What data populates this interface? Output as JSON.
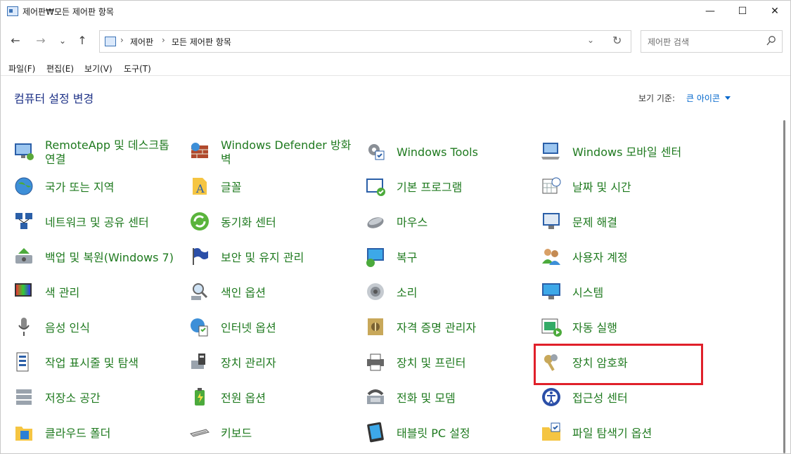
{
  "window": {
    "title": "제어판₩모든 제어판 항목"
  },
  "titlebar": {
    "minimize": "—",
    "maximize": "☐",
    "close": "✕"
  },
  "nav": {
    "back": "←",
    "forward": "→",
    "recent": "⌄",
    "up": "↑",
    "breadcrumb": [
      "제어판",
      "모든 제어판 항목"
    ],
    "separator": "›",
    "dropdown": "⌄",
    "refresh": "↻"
  },
  "search": {
    "placeholder": "제어판 검색"
  },
  "menu": [
    "파일(F)",
    "편집(E)",
    "보기(V)",
    "도구(T)"
  ],
  "content": {
    "heading": "컴퓨터 설정 변경",
    "view_by_label": "보기 기준:",
    "view_by_value": "큰 아이콘"
  },
  "colors": {
    "link_green": "#1f7a1f",
    "heading_blue": "#1e3287",
    "highlight_red": "#e0202a"
  },
  "items": [
    [
      {
        "label": "RemoteApp 및 데스크톱 연결",
        "icon": "remoteapp-icon"
      },
      {
        "label": "국가 또는 지역",
        "icon": "globe-clock-icon"
      },
      {
        "label": "네트워크 및 공유 센터",
        "icon": "network-icon"
      },
      {
        "label": "백업 및 복원(Windows 7)",
        "icon": "backup-icon"
      },
      {
        "label": "색 관리",
        "icon": "color-management-icon"
      },
      {
        "label": "음성 인식",
        "icon": "microphone-icon"
      },
      {
        "label": "작업 표시줄 및 탐색",
        "icon": "taskbar-icon"
      },
      {
        "label": "저장소 공간",
        "icon": "storage-icon"
      },
      {
        "label": "클라우드 폴더",
        "icon": "cloud-folder-icon"
      }
    ],
    [
      {
        "label": "Windows Defender 방화벽",
        "icon": "firewall-icon"
      },
      {
        "label": "글꼴",
        "icon": "font-icon"
      },
      {
        "label": "동기화 센터",
        "icon": "sync-icon"
      },
      {
        "label": "보안 및 유지 관리",
        "icon": "flag-icon"
      },
      {
        "label": "색인 옵션",
        "icon": "indexing-icon"
      },
      {
        "label": "인터넷 옵션",
        "icon": "internet-options-icon"
      },
      {
        "label": "장치 관리자",
        "icon": "device-manager-icon"
      },
      {
        "label": "전원 옵션",
        "icon": "power-icon"
      },
      {
        "label": "키보드",
        "icon": "keyboard-icon"
      }
    ],
    [
      {
        "label": "Windows Tools",
        "icon": "gear-icon"
      },
      {
        "label": "기본 프로그램",
        "icon": "default-programs-icon"
      },
      {
        "label": "마우스",
        "icon": "mouse-icon"
      },
      {
        "label": "복구",
        "icon": "recovery-icon"
      },
      {
        "label": "소리",
        "icon": "speaker-icon"
      },
      {
        "label": "자격 증명 관리자",
        "icon": "credential-vault-icon"
      },
      {
        "label": "장치 및 프린터",
        "icon": "printer-icon"
      },
      {
        "label": "전화 및 모뎀",
        "icon": "phone-modem-icon"
      },
      {
        "label": "태블릿 PC 설정",
        "icon": "tablet-icon"
      }
    ],
    [
      {
        "label": "Windows 모바일 센터",
        "icon": "mobility-center-icon"
      },
      {
        "label": "날짜 및 시간",
        "icon": "calendar-clock-icon"
      },
      {
        "label": "문제 해결",
        "icon": "troubleshoot-icon"
      },
      {
        "label": "사용자 계정",
        "icon": "users-icon"
      },
      {
        "label": "시스템",
        "icon": "system-icon"
      },
      {
        "label": "자동 실행",
        "icon": "autoplay-icon"
      },
      {
        "label": "장치 암호화",
        "icon": "keys-icon"
      },
      {
        "label": "접근성 센터",
        "icon": "accessibility-icon"
      },
      {
        "label": "파일 탐색기 옵션",
        "icon": "folder-options-icon"
      }
    ]
  ]
}
